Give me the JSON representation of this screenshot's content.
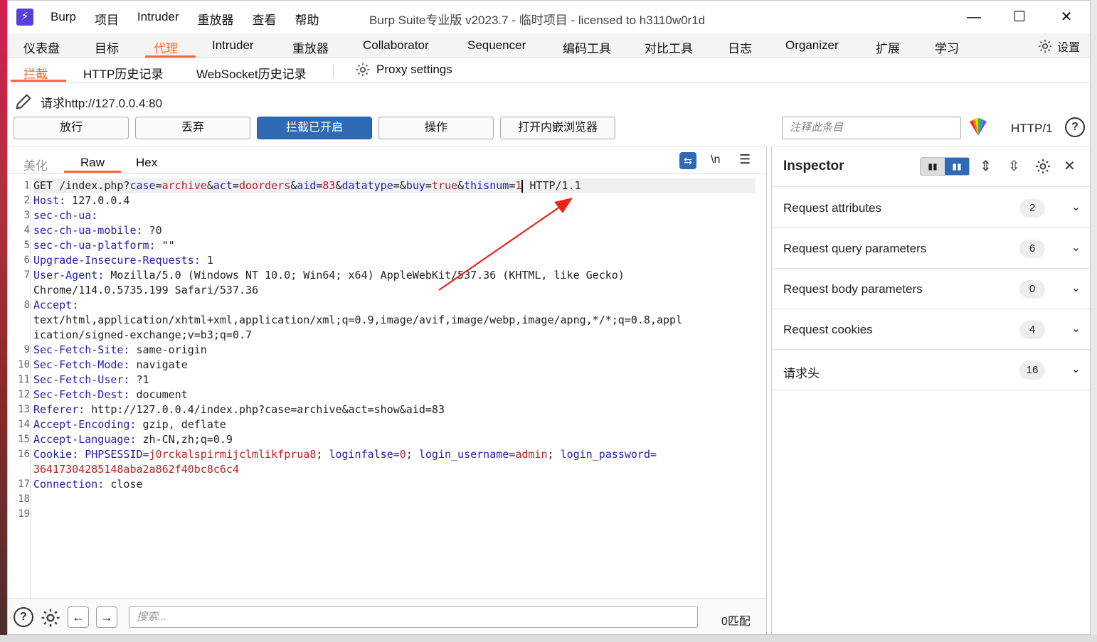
{
  "window": {
    "title": "Burp Suite专业版  v2023.7 - 临时项目 - licensed to h3110w0r1d",
    "logo": "⚡",
    "menu": [
      "Burp",
      "项目",
      "Intruder",
      "重放器",
      "查看",
      "帮助"
    ],
    "controls": {
      "minimize": "—",
      "maximize": "☐",
      "close": "✕"
    }
  },
  "main_tabs": [
    "仪表盘",
    "目标",
    "代理",
    "Intruder",
    "重放器",
    "Collaborator",
    "Sequencer",
    "编码工具",
    "对比工具",
    "日志",
    "Organizer",
    "扩展",
    "学习"
  ],
  "settings_label": "设置",
  "proxy_tabs": {
    "intercept": "拦截",
    "history": "HTTP历史记录",
    "websocket": "WebSocket历史记录",
    "settings": "Proxy settings"
  },
  "request_label": "请求http://127.0.0.4:80",
  "buttons": {
    "forward": "放行",
    "drop": "丢弃",
    "intercept": "拦截已开启",
    "action": "操作",
    "browser": "打开内嵌浏览器"
  },
  "comment_placeholder": "注释此条目",
  "http_version": "HTTP/1",
  "editor_tabs": {
    "pretty": "美化",
    "raw": "Raw",
    "hex": "Hex",
    "newline": "\\n"
  },
  "request_lines": [
    "1",
    "2",
    "3",
    "4",
    "5",
    "6",
    "7",
    "",
    "8",
    "",
    "",
    "9",
    "10",
    "11",
    "12",
    "13",
    "14",
    "15",
    "16",
    "",
    "17",
    "18",
    "19"
  ],
  "request": {
    "l1_method": "GET /index.php?",
    "l1_p1k": "case",
    "l1_p1v": "archive",
    "l1_p2k": "act",
    "l1_p2v": "doorders",
    "l1_p3k": "aid",
    "l1_p3v": "83",
    "l1_p4k": "datatype",
    "l1_p4v": "",
    "l1_p5k": "buy",
    "l1_p5v": "true",
    "l1_p6k": "thisnum",
    "l1_p6v": "1",
    "l1_proto": " HTTP/1.1",
    "host_k": "Host",
    "host_v": " 127.0.0.4",
    "ua_k": "sec-ch-ua",
    "ua_v": "",
    "mob_k": "sec-ch-ua-mobile",
    "mob_v": " ?0",
    "plat_k": "sec-ch-ua-platform",
    "plat_v": " \"\"",
    "uir_k": "Upgrade-Insecure-Requests",
    "uir_v": " 1",
    "agent_k": "User-Agent",
    "agent_v": " Mozilla/5.0 (Windows NT 10.0; Win64; x64) AppleWebKit/537.36 (KHTML, like Gecko)",
    "agent_v2": "Chrome/114.0.5735.199 Safari/537.36",
    "accept_k": "Accept",
    "accept_v1": "text/html,application/xhtml+xml,application/xml;q=0.9,image/avif,image/webp,image/apng,*/*;q=0.8,appl",
    "accept_v2": "ication/signed-exchange;v=b3;q=0.7",
    "site_k": "Sec-Fetch-Site",
    "site_v": " same-origin",
    "mode_k": "Sec-Fetch-Mode",
    "mode_v": " navigate",
    "user_k": "Sec-Fetch-User",
    "user_v": " ?1",
    "dest_k": "Sec-Fetch-Dest",
    "dest_v": " document",
    "ref_k": "Referer",
    "ref_v": " http://127.0.0.4/index.php?case=archive&act=show&aid=83",
    "enc_k": "Accept-Encoding",
    "enc_v": " gzip, deflate",
    "lang_k": "Accept-Language",
    "lang_v": " zh-CN,zh;q=0.9",
    "cookie_k": "Cookie",
    "c1k": "PHPSESSID",
    "c1v": "j0rckalspirmijclmlikfprua8",
    "c2k": "loginfalse",
    "c2v": "0",
    "c3k": "login_username",
    "c3v": "admin",
    "c4k": "login_password",
    "c4v": "36417304285148aba2a862f40bc8c6c4",
    "conn_k": "Connection",
    "conn_v": " close"
  },
  "search_placeholder": "搜索...",
  "matches": "0匹配",
  "inspector": {
    "title": "Inspector",
    "rows": [
      {
        "label": "Request attributes",
        "count": "2"
      },
      {
        "label": "Request query parameters",
        "count": "6"
      },
      {
        "label": "Request body parameters",
        "count": "0"
      },
      {
        "label": "Request cookies",
        "count": "4"
      },
      {
        "label": "请求头",
        "count": "16"
      }
    ]
  },
  "colors": {
    "accent": "#ff6633",
    "primary": "#2f6ab4",
    "header_key": "#2322a8",
    "param_value": "#b22222",
    "arrow": "#e8241c"
  }
}
